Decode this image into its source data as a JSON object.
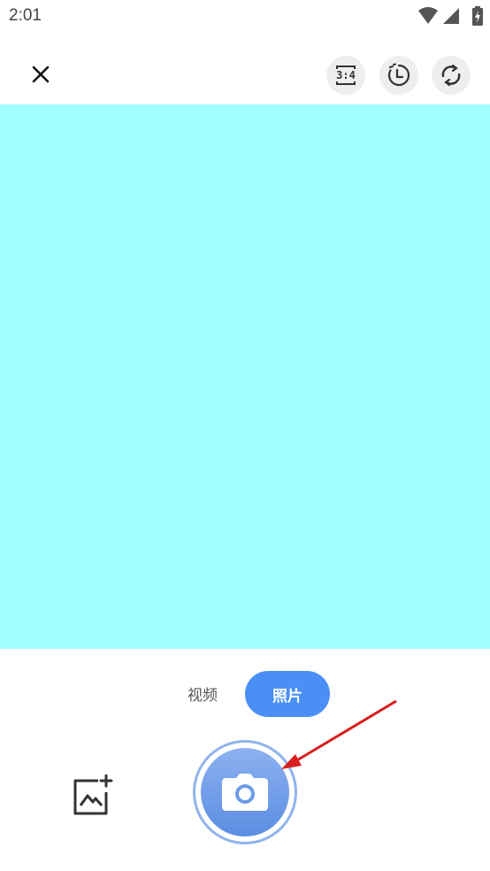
{
  "status_bar": {
    "time": "2:01"
  },
  "top_bar": {
    "ratio_label": "3:4"
  },
  "modes": {
    "video_label": "视频",
    "photo_label": "照片",
    "selected": "照片"
  },
  "colors": {
    "preview": "#a0ffff",
    "accent": "#4a8ff5",
    "annotation_arrow": "#d81e1e"
  },
  "icons": [
    "close-icon",
    "aspect-ratio-icon",
    "timer-icon",
    "switch-camera-icon",
    "gallery-add-icon",
    "camera-icon",
    "wifi-icon",
    "signal-icon",
    "battery-icon"
  ]
}
